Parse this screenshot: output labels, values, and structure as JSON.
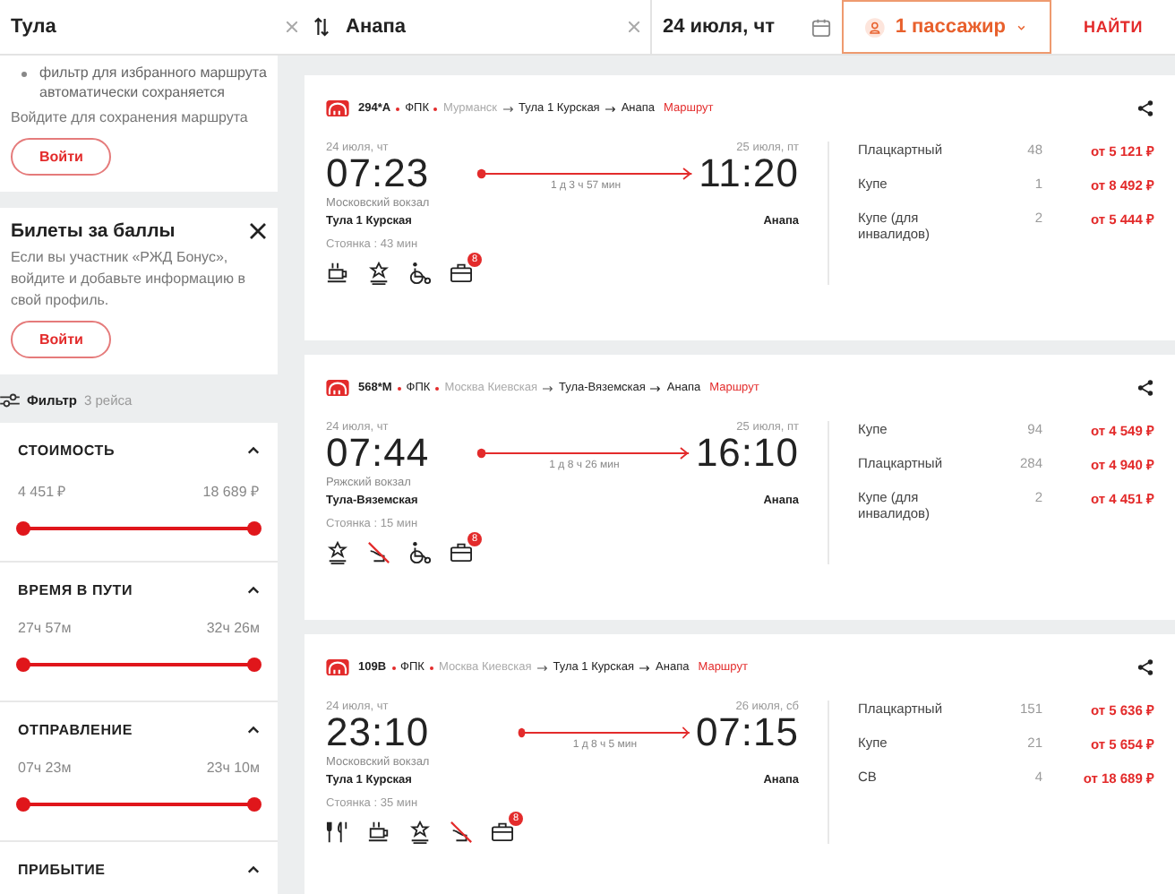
{
  "search": {
    "from": "Тула",
    "to": "Анапа",
    "date": "24 июля, чт",
    "passengers": "1 пассажир",
    "find_button": "НАЙТИ"
  },
  "sidebar": {
    "save_panel": {
      "bullets": [
        "фильтр для избранного маршрута автоматически сохраняется"
      ],
      "text": "Войдите для сохранения маршрута",
      "button": "Войти"
    },
    "bonus_card": {
      "title": "Билеты за баллы",
      "text": "Если вы участник «РЖД Бонус», войдите и добавьте информацию в свой профиль.",
      "button": "Войти"
    },
    "filter": {
      "label": "Фильтр",
      "count": "3 рейса"
    },
    "filter_sections": [
      {
        "title": "СТОИМОСТЬ",
        "expanded": true,
        "min": "4 451 ₽",
        "max": "18 689 ₽",
        "thumbs": [
          {
            "level": 0
          },
          {
            "level": 1
          }
        ]
      },
      {
        "title": "ВРЕМЯ В ПУТИ",
        "expanded": true,
        "min": "27ч 57м",
        "max": "32ч 26м",
        "thumbs": [
          {
            "level": 0
          },
          {
            "level": 1
          }
        ]
      },
      {
        "title": "ОТПРАВЛЕНИЕ",
        "expanded": true,
        "min": "07ч 23м",
        "max": "23ч 10м",
        "thumbs": [
          {
            "level": 0
          },
          {
            "level": 1
          }
        ]
      },
      {
        "title": "ПРИБЫТИЕ",
        "expanded": true
      }
    ]
  },
  "trains": [
    {
      "number": "294*А",
      "carrier": "ФПК",
      "origin": "Мурманск",
      "via": "Тула 1 Курская",
      "destination": "Анапа",
      "route_link": "Маршрут",
      "dep_date": "24 июля, чт",
      "dep_time": "07:23",
      "dep_station": "Московский вокзал",
      "dep_city": "Тула 1 Курская",
      "stop": "Стоянка : 43 мин",
      "duration": "1 д 3 ч 57 мин",
      "arr_date": "25 июля, пт",
      "arr_time": "11:20",
      "arr_city": "Анапа",
      "amenities": [
        {
          "kind": "cup"
        },
        {
          "kind": "award"
        },
        {
          "kind": "wheelchair"
        },
        {
          "kind": "bag",
          "badge": "8"
        }
      ],
      "classes": [
        {
          "name": "Плацкартный",
          "seats": "48",
          "price": "от 5 121 ₽"
        },
        {
          "name": "Купе",
          "seats": "1",
          "price": "от 8 492 ₽"
        },
        {
          "name": "Купе (для инвалидов)",
          "seats": "2",
          "price": "от 5 444 ₽"
        }
      ]
    },
    {
      "number": "568*М",
      "carrier": "ФПК",
      "origin": "Москва Киевская",
      "via": "Тула-Вяземская",
      "destination": "Анапа",
      "route_link": "Маршрут",
      "dep_date": "24 июля, чт",
      "dep_time": "07:44",
      "dep_station": "Ряжский вокзал",
      "dep_city": "Тула-Вяземская",
      "stop": "Стоянка : 15 мин",
      "duration": "1 д 8 ч 26 мин",
      "arr_date": "25 июля, пт",
      "arr_time": "16:10",
      "arr_city": "Анапа",
      "amenities": [
        {
          "kind": "award"
        },
        {
          "kind": "no-pets"
        },
        {
          "kind": "wheelchair"
        },
        {
          "kind": "bag",
          "badge": "8"
        }
      ],
      "classes": [
        {
          "name": "Купе",
          "seats": "94",
          "price": "от 4 549 ₽"
        },
        {
          "name": "Плацкартный",
          "seats": "284",
          "price": "от 4 940 ₽"
        },
        {
          "name": "Купе (для инвалидов)",
          "seats": "2",
          "price": "от 4 451 ₽"
        }
      ]
    },
    {
      "number": "109В",
      "carrier": "ФПК",
      "origin": "Москва Киевская",
      "via": "Тула 1 Курская",
      "destination": "Анапа",
      "route_link": "Маршрут",
      "dep_date": "24 июля, чт",
      "dep_time": "23:10",
      "dep_station": "Московский вокзал",
      "dep_city": "Тула 1 Курская",
      "stop": "Стоянка : 35 мин",
      "duration": "1 д 8 ч 5 мин",
      "arr_date": "26 июля, сб",
      "arr_time": "07:15",
      "arr_city": "Анапа",
      "amenities": [
        {
          "kind": "dining"
        },
        {
          "kind": "cup"
        },
        {
          "kind": "award"
        },
        {
          "kind": "no-pets"
        },
        {
          "kind": "bag",
          "badge": "8"
        }
      ],
      "classes": [
        {
          "name": "Плацкартный",
          "seats": "151",
          "price": "от 5 636 ₽"
        },
        {
          "name": "Купе",
          "seats": "21",
          "price": "от 5 654 ₽"
        },
        {
          "name": "СВ",
          "seats": "4",
          "price": "от 18 689 ₽"
        }
      ]
    }
  ]
}
